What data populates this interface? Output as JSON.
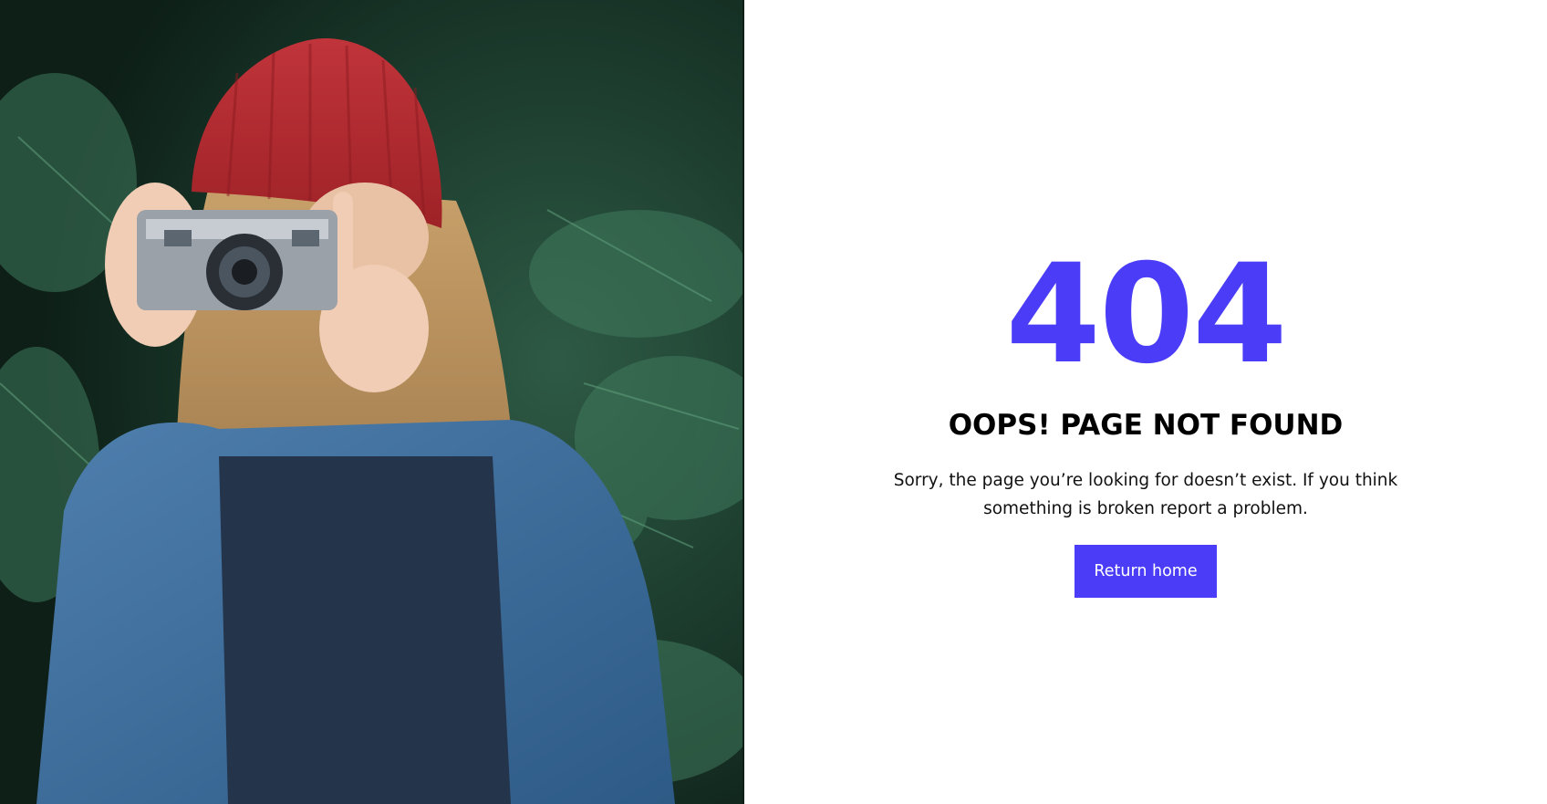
{
  "error": {
    "code": "404",
    "title": "OOPS! PAGE NOT FOUND",
    "message": "Sorry, the page you’re looking for doesn’t exist. If you think something is broken report a problem.",
    "button_label": "Return home"
  },
  "colors": {
    "accent": "#4a3cf7",
    "text": "#000000",
    "background": "#ffffff"
  }
}
